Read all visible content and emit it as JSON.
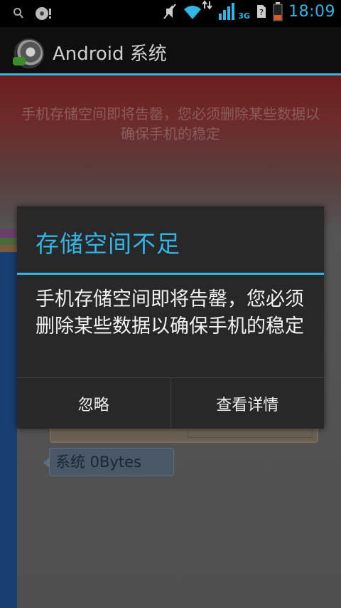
{
  "status_bar": {
    "time": "18:09",
    "network": "3G",
    "icons": [
      "search-icon",
      "disk-icon",
      "mute-icon",
      "wifi-icon",
      "data-arrows-icon",
      "signal-icon",
      "unknown-sim-icon",
      "battery-icon"
    ],
    "accent_color": "#33b5e5"
  },
  "action_bar": {
    "title": "Android 系统",
    "icon": "storage-disk-icon"
  },
  "background": {
    "warning_text": "手机存储空间即将告罄，您必须删除某些数据以确保手机的稳定",
    "tooltip_text": "系统 0Bytes"
  },
  "dialog": {
    "title": "存储空间不足",
    "message": "手机存储空间即将告罄，您必须删除某些数据以确保手机的稳定",
    "buttons": {
      "ignore": "忽略",
      "details": "查看详情"
    }
  }
}
